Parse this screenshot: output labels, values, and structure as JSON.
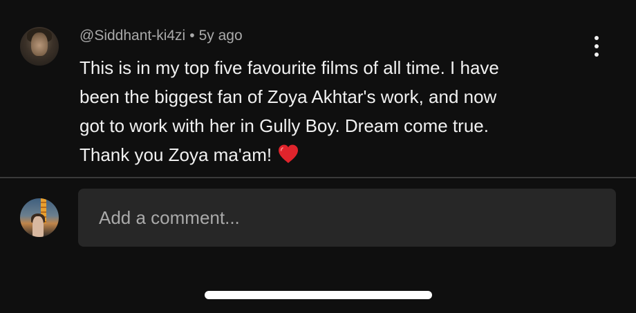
{
  "comment": {
    "author": "@Siddhant-ki4zi",
    "separator": "•",
    "age": "5y ago",
    "lines": [
      "This is in my top five favourite films of all time. I have",
      "been the biggest fan of Zoya Akhtar's work, and now",
      "got to work with her in Gully Boy. Dream come true.",
      "Thank you Zoya ma'am!"
    ],
    "emoji": "heart-icon",
    "menu_icon": "more-vertical-icon"
  },
  "composer": {
    "placeholder": "Add a comment...",
    "avatar_icon": "user-avatar"
  },
  "colors": {
    "background": "#0f0f0f",
    "primary_text": "#f1f1f1",
    "secondary_text": "#aaaaaa",
    "input_background": "#272727",
    "divider": "#3a3a3a",
    "heart": "#e0242c"
  }
}
